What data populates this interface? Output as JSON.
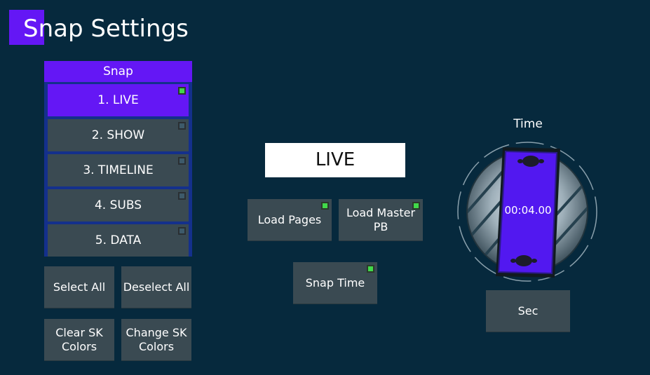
{
  "header": {
    "title": "Snap Settings"
  },
  "snap": {
    "header": "Snap",
    "items": [
      {
        "label": "1. LIVE",
        "selected": true,
        "indicator": "on"
      },
      {
        "label": "2. SHOW",
        "selected": false,
        "indicator": "off"
      },
      {
        "label": "3. TIMELINE",
        "selected": false,
        "indicator": "off"
      },
      {
        "label": "4. SUBS",
        "selected": false,
        "indicator": "off"
      },
      {
        "label": "5. DATA",
        "selected": false,
        "indicator": "off"
      }
    ]
  },
  "actions": {
    "select_all": "Select All",
    "deselect_all": "Deselect All",
    "clear_sk_colors_line1": "Clear SK",
    "clear_sk_colors_line2": "Colors",
    "change_sk_colors_line1": "Change SK",
    "change_sk_colors_line2": "Colors"
  },
  "center": {
    "display": "LIVE",
    "load_pages": "Load Pages",
    "load_master_line1": "Load Master",
    "load_master_line2": "PB",
    "snap_time": "Snap Time"
  },
  "time": {
    "label": "Time",
    "value": "00:04.00",
    "unit_button": "Sec"
  },
  "colors": {
    "background": "#06293d",
    "accent": "#6417f5",
    "button": "#3a4a52",
    "indicator_on": "#41d94a"
  }
}
